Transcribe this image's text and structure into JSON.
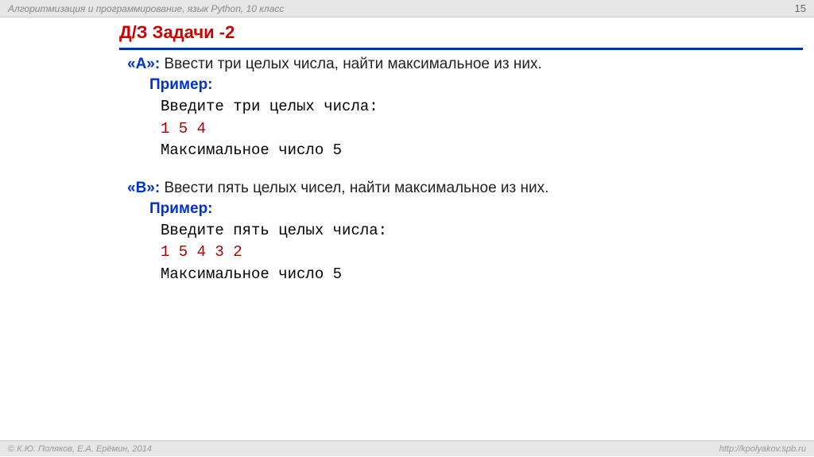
{
  "header": {
    "subject": "Алгоритмизация и программирование, язык Python, 10 класс",
    "page_number": "15"
  },
  "title": "Д/З  Задачи -2",
  "tasks": [
    {
      "tag": "«A»:",
      "desc": " Ввести три целых числа, найти максимальное из них.",
      "example_label": "Пример:",
      "lines": [
        {
          "text": "Введите три целых числа:",
          "color": "black"
        },
        {
          "text": "1 5 4",
          "color": "red"
        },
        {
          "text": "Максимальное число 5",
          "color": "black"
        }
      ]
    },
    {
      "tag": "«B»:",
      "desc": " Ввести пять целых чисел, найти максимальное из них.",
      "example_label": "Пример:",
      "lines": [
        {
          "text": "Введите пять целых числа:",
          "color": "black"
        },
        {
          "text": "1 5 4 3 2",
          "color": "red"
        },
        {
          "text": "Максимальное число 5",
          "color": "black"
        }
      ]
    }
  ],
  "footer": {
    "copyright": "© К.Ю. Поляков, Е.А. Ерёмин, 2014",
    "url": "http://kpolyakov.spb.ru"
  }
}
